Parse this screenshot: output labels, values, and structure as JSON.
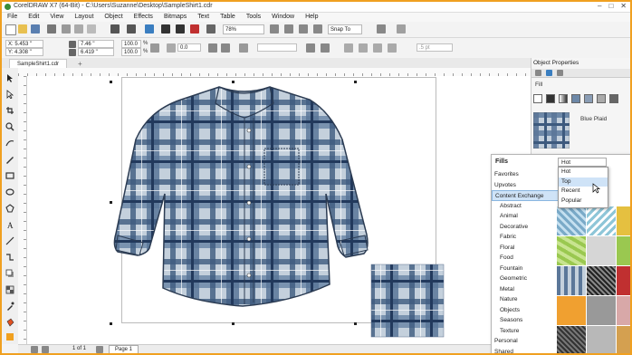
{
  "window": {
    "title": "CorelDRAW X7 (64-Bit) - C:\\Users\\Suzanne\\Desktop\\SampleShirt1.cdr"
  },
  "menu": [
    "File",
    "Edit",
    "View",
    "Layout",
    "Object",
    "Effects",
    "Bitmaps",
    "Text",
    "Table",
    "Tools",
    "Window",
    "Help"
  ],
  "toolbar": {
    "zoom": "78%",
    "snap_to": "Snap To"
  },
  "property_bar": {
    "x": "X: 5.453 \"",
    "y": "Y: 4.308 \"",
    "width": "7.46 \"",
    "height": "6.419 \"",
    "scale_w": "100.0",
    "scale_h": "100.0",
    "pct1": "%",
    "pct2": "%",
    "rotation": "0.0",
    "outline": ".5 pt"
  },
  "tabs": {
    "document": "SampleShirt1.cdr"
  },
  "docker": {
    "title": "Object Properties",
    "fill_label": "Fill",
    "fill_name": "Blue Plaid"
  },
  "fills_panel": {
    "title": "Fills",
    "categories": [
      {
        "label": "Favorites",
        "sub": false,
        "active": false
      },
      {
        "label": "Upvotes",
        "sub": false,
        "active": false
      },
      {
        "label": "Content Exchange",
        "sub": false,
        "active": true
      },
      {
        "label": "Abstract",
        "sub": true,
        "active": false
      },
      {
        "label": "Animal",
        "sub": true,
        "active": false
      },
      {
        "label": "Decorative",
        "sub": true,
        "active": false
      },
      {
        "label": "Fabric",
        "sub": true,
        "active": false
      },
      {
        "label": "Floral",
        "sub": true,
        "active": false
      },
      {
        "label": "Food",
        "sub": true,
        "active": false
      },
      {
        "label": "Fountain",
        "sub": true,
        "active": false
      },
      {
        "label": "Geometric",
        "sub": true,
        "active": false
      },
      {
        "label": "Metal",
        "sub": true,
        "active": false
      },
      {
        "label": "Nature",
        "sub": true,
        "active": false
      },
      {
        "label": "Objects",
        "sub": true,
        "active": false
      },
      {
        "label": "Seasons",
        "sub": true,
        "active": false
      },
      {
        "label": "Texture",
        "sub": true,
        "active": false
      },
      {
        "label": "Personal",
        "sub": false,
        "active": false
      },
      {
        "label": "Shared",
        "sub": false,
        "active": false
      }
    ],
    "sort": {
      "selected": "Hot",
      "options": [
        "Hot",
        "Top",
        "Recent",
        "Popular"
      ],
      "highlighted": "Top"
    }
  },
  "status": {
    "page_count": "1 of 1",
    "page_tab": "Page 1"
  }
}
